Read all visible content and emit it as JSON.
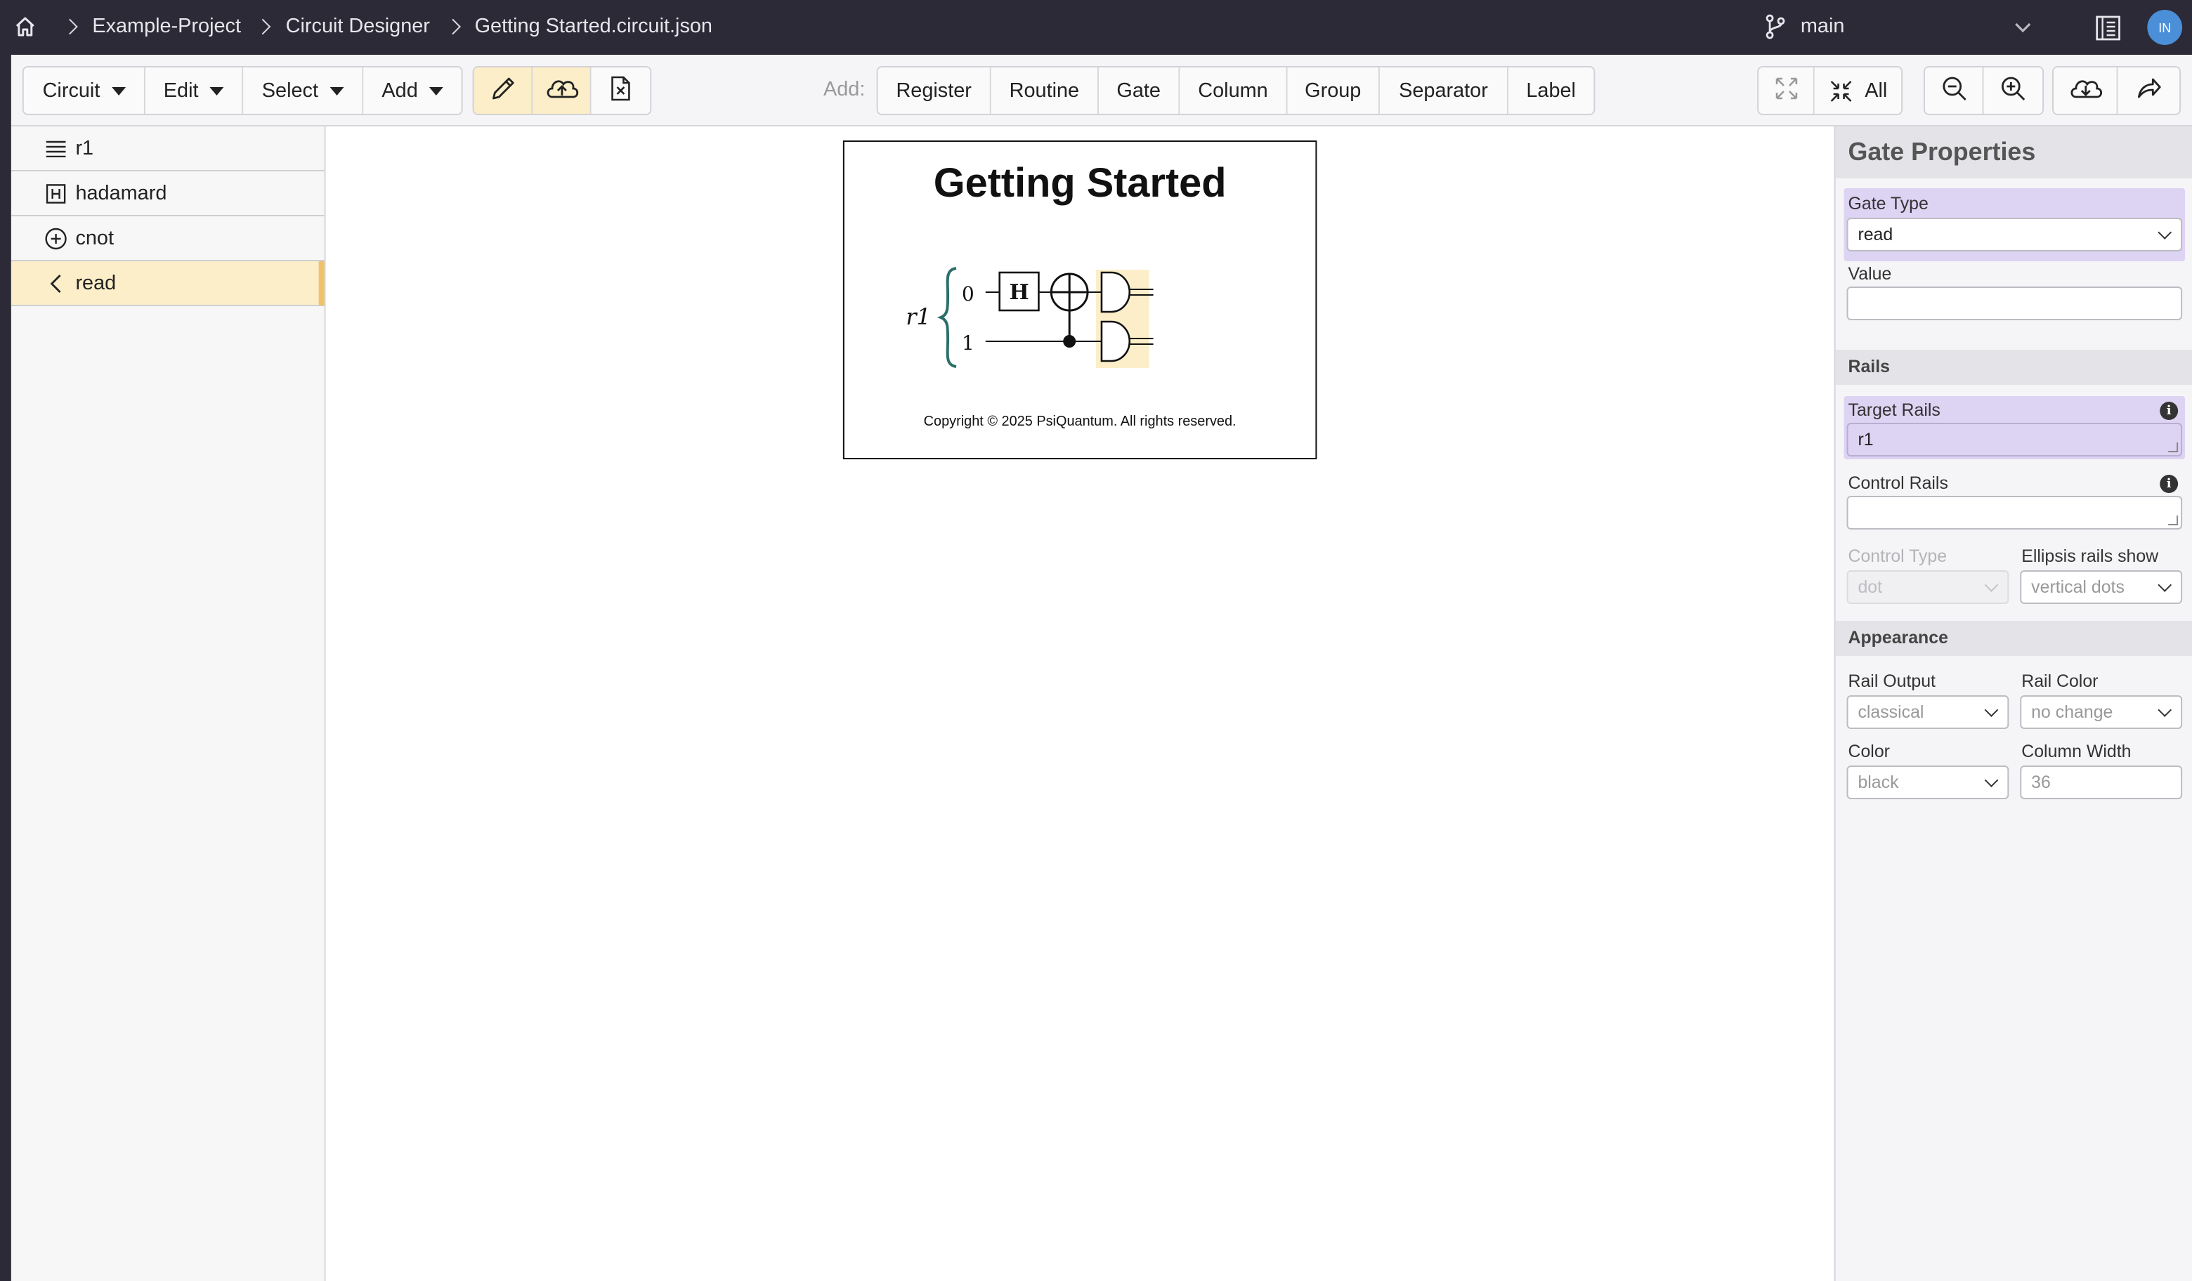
{
  "breadcrumb": {
    "project": "Example-Project",
    "app": "Circuit Designer",
    "file": "Getting Started.circuit.json"
  },
  "branch": {
    "name": "main"
  },
  "user": {
    "initials": "IN"
  },
  "toolbar": {
    "menus": [
      "Circuit",
      "Edit",
      "Select",
      "Add"
    ],
    "add_label": "Add:",
    "add_buttons": [
      "Register",
      "Routine",
      "Gate",
      "Column",
      "Group",
      "Separator",
      "Label"
    ],
    "expand_all_label": "All"
  },
  "tree": {
    "items": [
      {
        "label": "r1",
        "icon": "list-icon"
      },
      {
        "label": "hadamard",
        "icon": "h-box-icon"
      },
      {
        "label": "cnot",
        "icon": "circle-plus-icon"
      },
      {
        "label": "read",
        "icon": "chevron-left-icon"
      }
    ]
  },
  "canvas": {
    "title": "Getting Started",
    "register_label": "r1",
    "rail_labels": [
      "0",
      "1"
    ],
    "h_gate_label": "H",
    "copyright": "Copyright © 2025 PsiQuantum. All rights reserved."
  },
  "props": {
    "title": "Gate Properties",
    "gate_type_label": "Gate Type",
    "gate_type_value": "read",
    "value_label": "Value",
    "value_value": "",
    "rails_section": "Rails",
    "target_rails_label": "Target Rails",
    "target_rails_value": "r1",
    "control_rails_label": "Control Rails",
    "control_rails_value": "",
    "control_type_label": "Control Type",
    "control_type_value": "dot",
    "ellipsis_label": "Ellipsis rails show",
    "ellipsis_value": "vertical dots",
    "appearance_section": "Appearance",
    "rail_output_label": "Rail Output",
    "rail_output_value": "classical",
    "rail_color_label": "Rail Color",
    "rail_color_value": "no change",
    "color_label": "Color",
    "color_value": "black",
    "column_width_label": "Column Width",
    "column_width_value": "36"
  },
  "colors": {
    "topbar": "#2b2a36",
    "highlight": "#ddd3f3",
    "selected": "#fbeec8",
    "selected_border": "#f0c36a",
    "brace": "#2b6f6a"
  }
}
